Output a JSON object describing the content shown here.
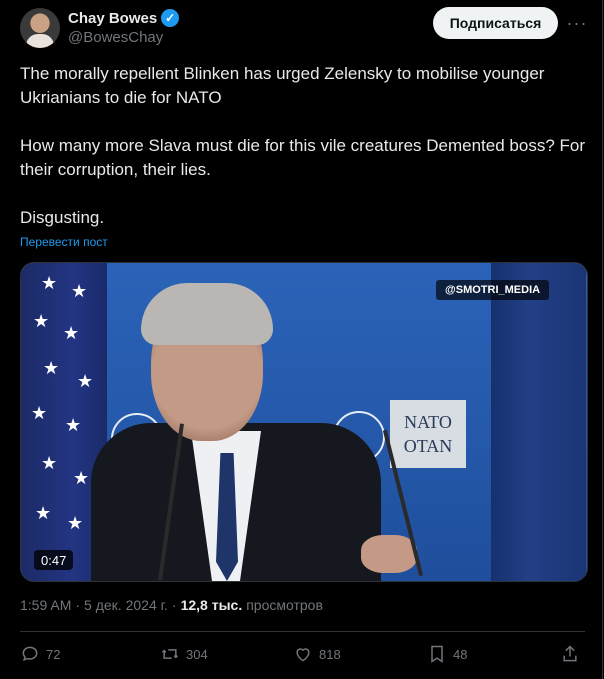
{
  "author": {
    "name": "Chay Bowes",
    "handle": "@BowesChay",
    "verified_icon": "verified-badge-icon"
  },
  "header": {
    "subscribe_label": "Подписаться",
    "more_icon": "more-icon"
  },
  "post": {
    "line1": "The morally repellent Blinken has urged Zelensky to mobilise younger Ukrianians to die for NATO",
    "line2": "How many more Slava must die for this vile creatures Demented boss? For their corruption, their lies.",
    "line3": "Disgusting.",
    "translate_label": "Перевести пост"
  },
  "media": {
    "watermark": "@SMOTRI_MEDIA",
    "sign_line1": "NATO",
    "sign_line2": "OTAN",
    "duration": "0:47"
  },
  "meta": {
    "time": "1:59 AM",
    "separator": "·",
    "date": "5 дек. 2024 г.",
    "separator2": "·",
    "views_count": "12,8 тыс.",
    "views_label": "просмотров"
  },
  "actions": {
    "replies": "72",
    "reposts": "304",
    "likes": "818",
    "bookmarks": "48"
  },
  "colors": {
    "background": "#000000",
    "accent": "#1d9bf0",
    "muted": "#71767b",
    "text": "#e7e9ea"
  }
}
